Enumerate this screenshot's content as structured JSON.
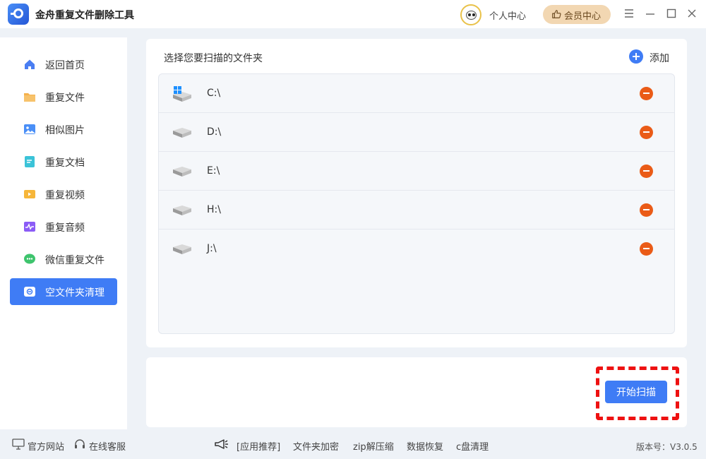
{
  "app": {
    "title": "金舟重复文件删除工具",
    "user_center": "个人中心",
    "vip_center": "会员中心"
  },
  "sidebar": {
    "items": [
      {
        "label": "返回首页",
        "icon": "home-icon"
      },
      {
        "label": "重复文件",
        "icon": "folder-icon"
      },
      {
        "label": "相似图片",
        "icon": "image-icon"
      },
      {
        "label": "重复文档",
        "icon": "document-icon"
      },
      {
        "label": "重复视频",
        "icon": "video-icon"
      },
      {
        "label": "重复音频",
        "icon": "audio-icon"
      },
      {
        "label": "微信重复文件",
        "icon": "wechat-icon"
      },
      {
        "label": "空文件夹清理",
        "icon": "empty-folder-icon",
        "active": true
      }
    ]
  },
  "panel": {
    "title": "选择您要扫描的文件夹",
    "add_label": "添加",
    "drives": [
      {
        "path": "C:\\",
        "icon": "windows-drive-icon"
      },
      {
        "path": "D:\\",
        "icon": "drive-icon"
      },
      {
        "path": "E:\\",
        "icon": "drive-icon"
      },
      {
        "path": "H:\\",
        "icon": "drive-icon"
      },
      {
        "path": "J:\\",
        "icon": "drive-icon"
      }
    ]
  },
  "actions": {
    "start_scan": "开始扫描"
  },
  "footer": {
    "website": "官方网站",
    "support": "在线客服",
    "recommend": "[应用推荐]",
    "links": [
      "文件夹加密",
      "zip解压缩",
      "数据恢复",
      "c盘清理"
    ],
    "version": "版本号：V3.0.5"
  },
  "colors": {
    "accent": "#3f7cf5",
    "remove": "#ea5b17",
    "highlight": "#ee1111",
    "vip": "#f2d7b2"
  }
}
